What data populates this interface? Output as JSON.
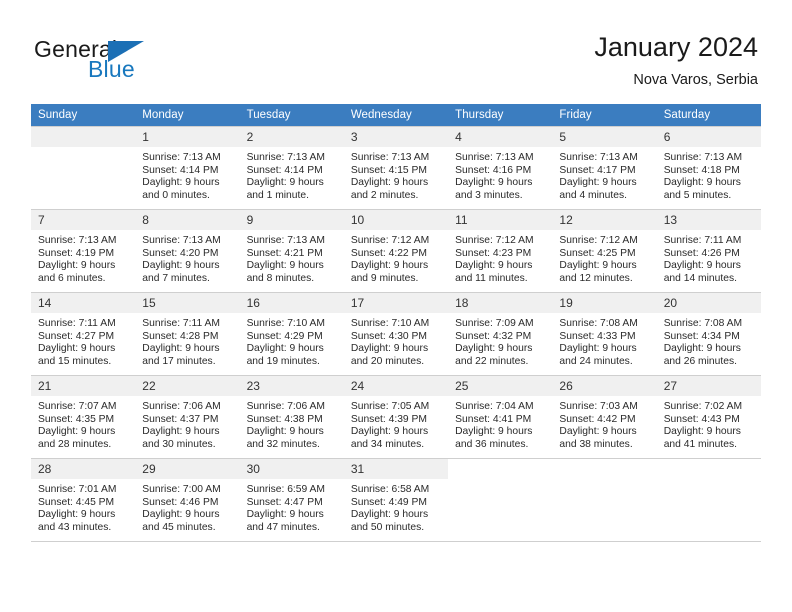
{
  "brand": {
    "name_top": "General",
    "name_bottom": "Blue",
    "accent_color": "#1b6fb5"
  },
  "header": {
    "title": "January 2024",
    "subtitle": "Nova Varos, Serbia"
  },
  "calendar": {
    "header_bg": "#3b7dc0",
    "daynum_bg": "#f0f0f0",
    "weekday_headers": [
      "Sunday",
      "Monday",
      "Tuesday",
      "Wednesday",
      "Thursday",
      "Friday",
      "Saturday"
    ],
    "weeks": [
      [
        {
          "day": "",
          "lines": []
        },
        {
          "day": "1",
          "lines": [
            "Sunrise: 7:13 AM",
            "Sunset: 4:14 PM",
            "Daylight: 9 hours",
            "and 0 minutes."
          ]
        },
        {
          "day": "2",
          "lines": [
            "Sunrise: 7:13 AM",
            "Sunset: 4:14 PM",
            "Daylight: 9 hours",
            "and 1 minute."
          ]
        },
        {
          "day": "3",
          "lines": [
            "Sunrise: 7:13 AM",
            "Sunset: 4:15 PM",
            "Daylight: 9 hours",
            "and 2 minutes."
          ]
        },
        {
          "day": "4",
          "lines": [
            "Sunrise: 7:13 AM",
            "Sunset: 4:16 PM",
            "Daylight: 9 hours",
            "and 3 minutes."
          ]
        },
        {
          "day": "5",
          "lines": [
            "Sunrise: 7:13 AM",
            "Sunset: 4:17 PM",
            "Daylight: 9 hours",
            "and 4 minutes."
          ]
        },
        {
          "day": "6",
          "lines": [
            "Sunrise: 7:13 AM",
            "Sunset: 4:18 PM",
            "Daylight: 9 hours",
            "and 5 minutes."
          ]
        }
      ],
      [
        {
          "day": "7",
          "lines": [
            "Sunrise: 7:13 AM",
            "Sunset: 4:19 PM",
            "Daylight: 9 hours",
            "and 6 minutes."
          ]
        },
        {
          "day": "8",
          "lines": [
            "Sunrise: 7:13 AM",
            "Sunset: 4:20 PM",
            "Daylight: 9 hours",
            "and 7 minutes."
          ]
        },
        {
          "day": "9",
          "lines": [
            "Sunrise: 7:13 AM",
            "Sunset: 4:21 PM",
            "Daylight: 9 hours",
            "and 8 minutes."
          ]
        },
        {
          "day": "10",
          "lines": [
            "Sunrise: 7:12 AM",
            "Sunset: 4:22 PM",
            "Daylight: 9 hours",
            "and 9 minutes."
          ]
        },
        {
          "day": "11",
          "lines": [
            "Sunrise: 7:12 AM",
            "Sunset: 4:23 PM",
            "Daylight: 9 hours",
            "and 11 minutes."
          ]
        },
        {
          "day": "12",
          "lines": [
            "Sunrise: 7:12 AM",
            "Sunset: 4:25 PM",
            "Daylight: 9 hours",
            "and 12 minutes."
          ]
        },
        {
          "day": "13",
          "lines": [
            "Sunrise: 7:11 AM",
            "Sunset: 4:26 PM",
            "Daylight: 9 hours",
            "and 14 minutes."
          ]
        }
      ],
      [
        {
          "day": "14",
          "lines": [
            "Sunrise: 7:11 AM",
            "Sunset: 4:27 PM",
            "Daylight: 9 hours",
            "and 15 minutes."
          ]
        },
        {
          "day": "15",
          "lines": [
            "Sunrise: 7:11 AM",
            "Sunset: 4:28 PM",
            "Daylight: 9 hours",
            "and 17 minutes."
          ]
        },
        {
          "day": "16",
          "lines": [
            "Sunrise: 7:10 AM",
            "Sunset: 4:29 PM",
            "Daylight: 9 hours",
            "and 19 minutes."
          ]
        },
        {
          "day": "17",
          "lines": [
            "Sunrise: 7:10 AM",
            "Sunset: 4:30 PM",
            "Daylight: 9 hours",
            "and 20 minutes."
          ]
        },
        {
          "day": "18",
          "lines": [
            "Sunrise: 7:09 AM",
            "Sunset: 4:32 PM",
            "Daylight: 9 hours",
            "and 22 minutes."
          ]
        },
        {
          "day": "19",
          "lines": [
            "Sunrise: 7:08 AM",
            "Sunset: 4:33 PM",
            "Daylight: 9 hours",
            "and 24 minutes."
          ]
        },
        {
          "day": "20",
          "lines": [
            "Sunrise: 7:08 AM",
            "Sunset: 4:34 PM",
            "Daylight: 9 hours",
            "and 26 minutes."
          ]
        }
      ],
      [
        {
          "day": "21",
          "lines": [
            "Sunrise: 7:07 AM",
            "Sunset: 4:35 PM",
            "Daylight: 9 hours",
            "and 28 minutes."
          ]
        },
        {
          "day": "22",
          "lines": [
            "Sunrise: 7:06 AM",
            "Sunset: 4:37 PM",
            "Daylight: 9 hours",
            "and 30 minutes."
          ]
        },
        {
          "day": "23",
          "lines": [
            "Sunrise: 7:06 AM",
            "Sunset: 4:38 PM",
            "Daylight: 9 hours",
            "and 32 minutes."
          ]
        },
        {
          "day": "24",
          "lines": [
            "Sunrise: 7:05 AM",
            "Sunset: 4:39 PM",
            "Daylight: 9 hours",
            "and 34 minutes."
          ]
        },
        {
          "day": "25",
          "lines": [
            "Sunrise: 7:04 AM",
            "Sunset: 4:41 PM",
            "Daylight: 9 hours",
            "and 36 minutes."
          ]
        },
        {
          "day": "26",
          "lines": [
            "Sunrise: 7:03 AM",
            "Sunset: 4:42 PM",
            "Daylight: 9 hours",
            "and 38 minutes."
          ]
        },
        {
          "day": "27",
          "lines": [
            "Sunrise: 7:02 AM",
            "Sunset: 4:43 PM",
            "Daylight: 9 hours",
            "and 41 minutes."
          ]
        }
      ],
      [
        {
          "day": "28",
          "lines": [
            "Sunrise: 7:01 AM",
            "Sunset: 4:45 PM",
            "Daylight: 9 hours",
            "and 43 minutes."
          ]
        },
        {
          "day": "29",
          "lines": [
            "Sunrise: 7:00 AM",
            "Sunset: 4:46 PM",
            "Daylight: 9 hours",
            "and 45 minutes."
          ]
        },
        {
          "day": "30",
          "lines": [
            "Sunrise: 6:59 AM",
            "Sunset: 4:47 PM",
            "Daylight: 9 hours",
            "and 47 minutes."
          ]
        },
        {
          "day": "31",
          "lines": [
            "Sunrise: 6:58 AM",
            "Sunset: 4:49 PM",
            "Daylight: 9 hours",
            "and 50 minutes."
          ]
        },
        {
          "day": "",
          "lines": []
        },
        {
          "day": "",
          "lines": []
        },
        {
          "day": "",
          "lines": []
        }
      ]
    ]
  }
}
